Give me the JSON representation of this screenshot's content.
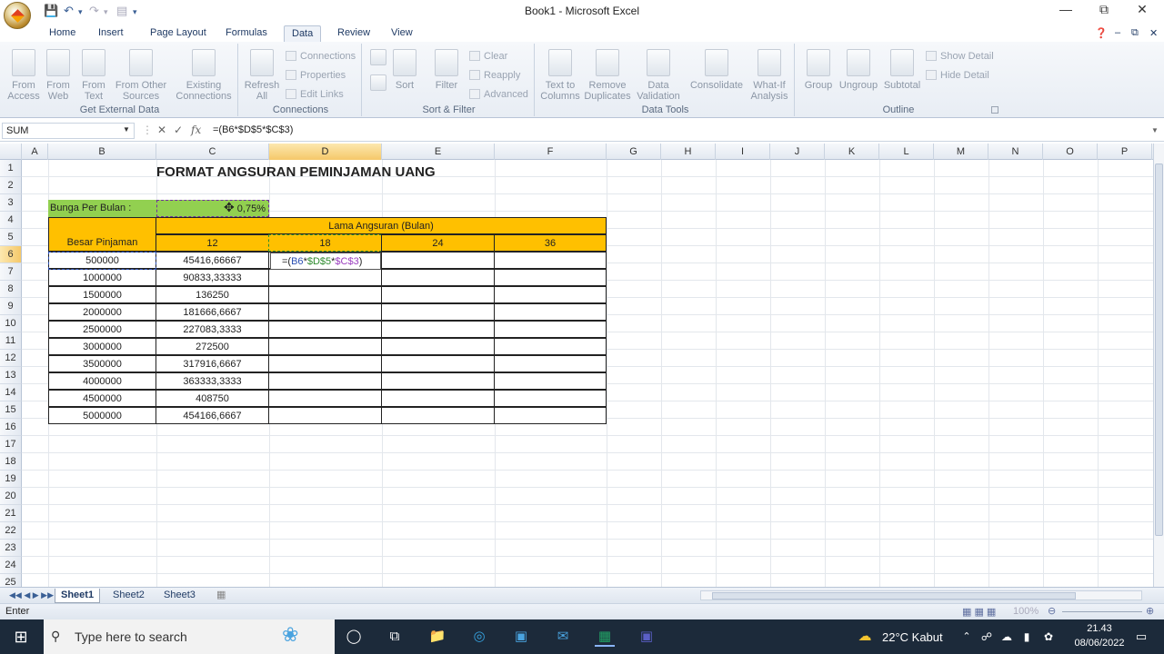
{
  "window": {
    "title": "Book1 - Microsoft Excel"
  },
  "tabs": [
    "Home",
    "Insert",
    "Page Layout",
    "Formulas",
    "Data",
    "Review",
    "View"
  ],
  "ribbon": {
    "groups": {
      "external": "Get External Data",
      "connections": "Connections",
      "sortfilter": "Sort & Filter",
      "datatools": "Data Tools",
      "outline": "Outline"
    },
    "buttons": {
      "from_access": "From\nAccess",
      "from_web": "From\nWeb",
      "from_text": "From\nText",
      "from_other": "From Other\nSources",
      "existing": "Existing\nConnections",
      "refresh": "Refresh\nAll",
      "connections": "Connections",
      "properties": "Properties",
      "edit_links": "Edit Links",
      "sort": "Sort",
      "filter": "Filter",
      "clear": "Clear",
      "reapply": "Reapply",
      "advanced": "Advanced",
      "text_to_columns": "Text to\nColumns",
      "remove_duplicates": "Remove\nDuplicates",
      "data_validation": "Data\nValidation",
      "consolidate": "Consolidate",
      "what_if": "What-If\nAnalysis",
      "group": "Group",
      "ungroup": "Ungroup",
      "subtotal": "Subtotal",
      "show_detail": "Show Detail",
      "hide_detail": "Hide Detail"
    }
  },
  "formula_bar": {
    "name_box": "SUM",
    "formula": "=(B6*$D$5*$C$3)"
  },
  "columns": [
    "A",
    "B",
    "C",
    "D",
    "E",
    "F",
    "G",
    "H",
    "I",
    "J",
    "K",
    "L",
    "M",
    "N",
    "O",
    "P"
  ],
  "rows": [
    "1",
    "2",
    "3",
    "4",
    "5",
    "6",
    "7",
    "8",
    "9",
    "10",
    "11",
    "12",
    "13",
    "14",
    "15",
    "16",
    "17",
    "18",
    "19",
    "20",
    "21",
    "22",
    "23",
    "24",
    "25"
  ],
  "sheet": {
    "title": "FORMAT ANGSURAN PEMINJAMAN UANG",
    "bunga_label": "Bunga Per Bulan :",
    "bunga_value": "0,75%",
    "lama_header": "Lama Angsuran (Bulan)",
    "besar_header": "Besar Pinjaman",
    "months": [
      "12",
      "18",
      "24",
      "36"
    ],
    "editing_formula": "=(B6*$D$5*$C$3)",
    "loans": [
      "500000",
      "1000000",
      "1500000",
      "2000000",
      "2500000",
      "3000000",
      "3500000",
      "4000000",
      "4500000",
      "5000000"
    ],
    "col_c": [
      "45416,66667",
      "90833,33333",
      "136250",
      "181666,6667",
      "227083,3333",
      "272500",
      "317916,6667",
      "363333,3333",
      "408750",
      "454166,6667"
    ]
  },
  "sheet_tabs": [
    "Sheet1",
    "Sheet2",
    "Sheet3"
  ],
  "status": {
    "mode": "Enter",
    "zoom": "100%"
  },
  "taskbar": {
    "search_placeholder": "Type here to search",
    "weather": "22°C  Kabut",
    "time": "21.43",
    "date": "08/06/2022"
  },
  "colors": {
    "orange": "#ffc000",
    "green": "#92d050",
    "accent": "#2b579a"
  }
}
